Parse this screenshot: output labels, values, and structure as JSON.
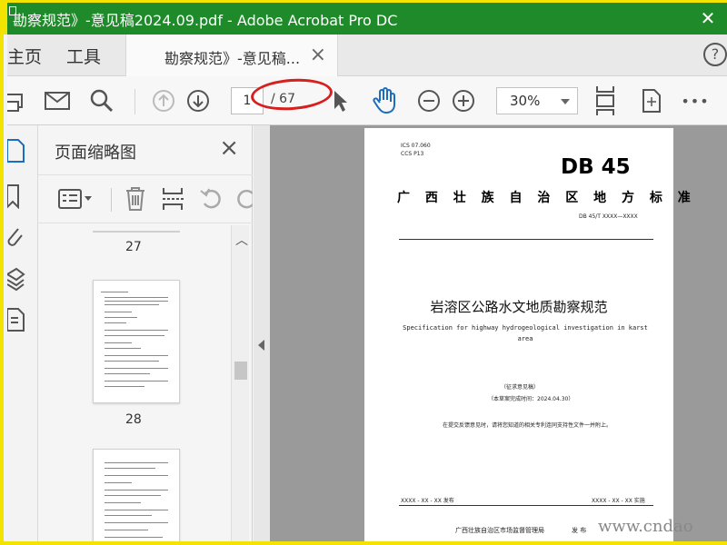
{
  "window": {
    "title": "勘察规范》-意见稿2024.09.pdf - Adobe Acrobat Pro DC",
    "close_glyph": "✕"
  },
  "tabs": {
    "home": "主页",
    "tools": "工具",
    "document": "勘察规范》-意见稿...",
    "document_close": "×",
    "help": "?"
  },
  "toolbar": {
    "page_current": "1",
    "page_total": "/ 67",
    "zoom": "30%",
    "more": "•••"
  },
  "left_panel": {
    "title": "页面缩略图",
    "close": "×",
    "thumbnails": [
      {
        "page": "27"
      },
      {
        "page": "28"
      }
    ]
  },
  "document": {
    "ics": "ICS 07.060",
    "ccs": "CCS P13",
    "logo": "DB 45",
    "standard_type": "广 西 壮 族 自 治 区 地 方 标 准",
    "standard_no": "DB 45/T XXXX—XXXX",
    "title_cn": "岩溶区公路水文地质勘察规范",
    "title_en": "Specification for highway hydrogeological investigation in karst area",
    "draft": "（征求意见稿）",
    "draft_date": "（本草案完成时间：2024.04.30）",
    "notice": "在提交反馈意见时，请将您知道的相关专利连同支持性文件一并附上。",
    "publish": "XXXX - XX - XX 发布",
    "implement": "XXXX - XX - XX 实施",
    "issuer": "广西壮族自治区市场监督管理局",
    "issuer_suffix": "发 布"
  },
  "watermark": "www.cndao"
}
